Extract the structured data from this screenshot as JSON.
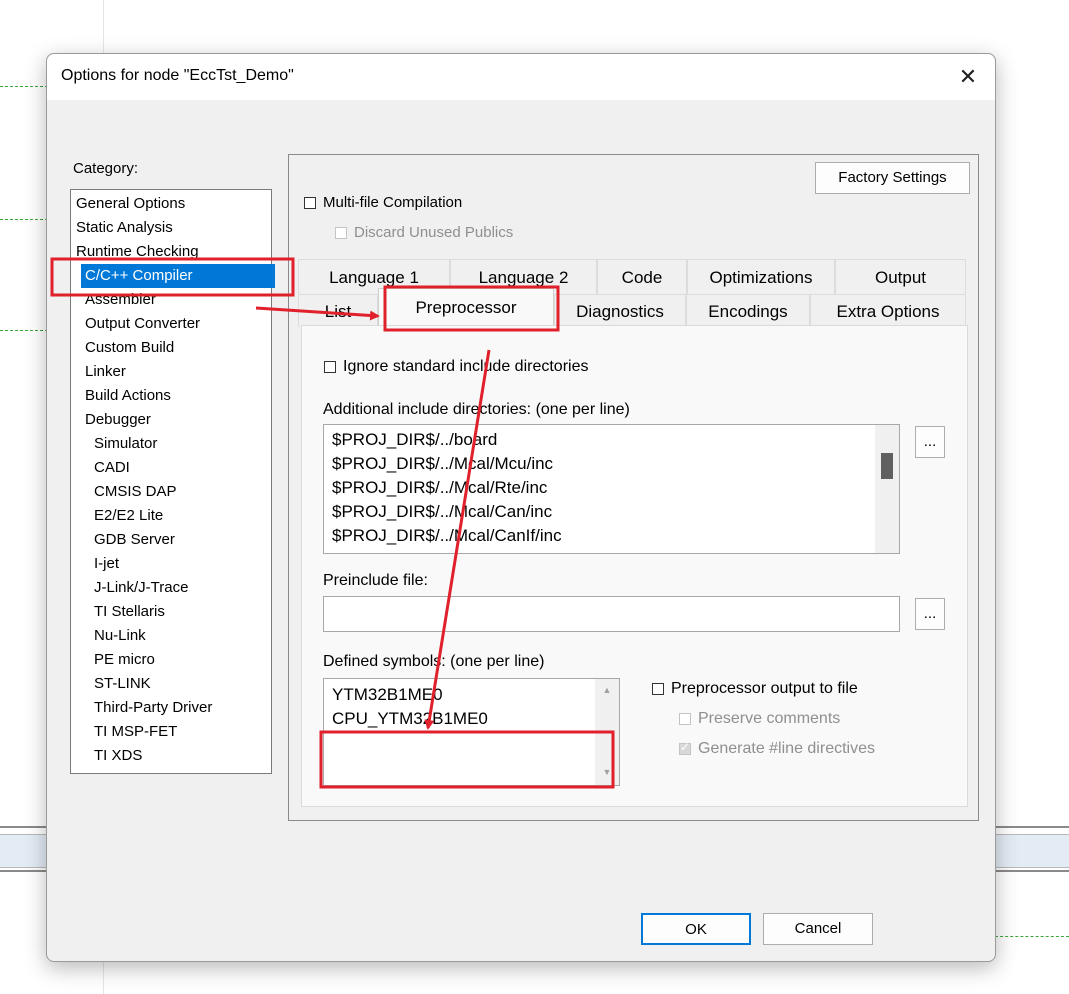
{
  "dialog": {
    "title": "Options for node \"EccTst_Demo\"",
    "close_glyph": "✕"
  },
  "category": {
    "label": "Category:",
    "items": [
      {
        "label": "General Options",
        "indent": 0
      },
      {
        "label": "Static Analysis",
        "indent": 0
      },
      {
        "label": "Runtime Checking",
        "indent": 0
      },
      {
        "label": "C/C++ Compiler",
        "indent": 1,
        "selected": true
      },
      {
        "label": "Assembler",
        "indent": 1
      },
      {
        "label": "Output Converter",
        "indent": 1
      },
      {
        "label": "Custom Build",
        "indent": 1
      },
      {
        "label": "Linker",
        "indent": 1
      },
      {
        "label": "Build Actions",
        "indent": 1
      },
      {
        "label": "Debugger",
        "indent": 1
      },
      {
        "label": "Simulator",
        "indent": 2
      },
      {
        "label": "CADI",
        "indent": 2
      },
      {
        "label": "CMSIS DAP",
        "indent": 2
      },
      {
        "label": "E2/E2 Lite",
        "indent": 2
      },
      {
        "label": "GDB Server",
        "indent": 2
      },
      {
        "label": "I-jet",
        "indent": 2
      },
      {
        "label": "J-Link/J-Trace",
        "indent": 2
      },
      {
        "label": "TI Stellaris",
        "indent": 2
      },
      {
        "label": "Nu-Link",
        "indent": 2
      },
      {
        "label": "PE micro",
        "indent": 2
      },
      {
        "label": "ST-LINK",
        "indent": 2
      },
      {
        "label": "Third-Party Driver",
        "indent": 2
      },
      {
        "label": "TI MSP-FET",
        "indent": 2
      },
      {
        "label": "TI XDS",
        "indent": 2
      }
    ]
  },
  "panel": {
    "factory_settings": "Factory Settings",
    "multi_file": "Multi-file Compilation",
    "discard_unused": "Discard Unused Publics",
    "tabs_row1": [
      "Language 1",
      "Language 2",
      "Code",
      "Optimizations",
      "Output"
    ],
    "tabs_row2": [
      "List",
      "Preprocessor",
      "Diagnostics",
      "Encodings",
      "Extra Options"
    ],
    "active_tab": "Preprocessor"
  },
  "preprocessor": {
    "ignore_std": "Ignore standard include directories",
    "include_label": "Additional include directories: (one per line)",
    "include_dirs": [
      "$PROJ_DIR$/../board",
      "$PROJ_DIR$/../Mcal/Mcu/inc",
      "$PROJ_DIR$/../Mcal/Rte/inc",
      "$PROJ_DIR$/../Mcal/Can/inc",
      "$PROJ_DIR$/../Mcal/CanIf/inc"
    ],
    "browse": "...",
    "preinclude_label": "Preinclude file:",
    "preinclude_value": "",
    "defined_label": "Defined symbols: (one per line)",
    "defined_symbols": [
      "YTM32B1ME0",
      "CPU_YTM32B1ME0"
    ],
    "pp_output": "Preprocessor output to file",
    "preserve_comments": "Preserve comments",
    "generate_line": "Generate #line directives"
  },
  "footer": {
    "ok": "OK",
    "cancel": "Cancel"
  },
  "colors": {
    "selection": "#0078d7",
    "annotation": "#e0202a"
  }
}
